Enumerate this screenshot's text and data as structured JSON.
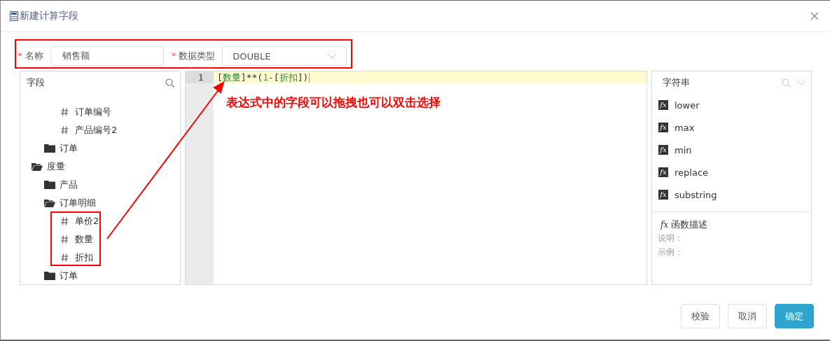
{
  "dialog": {
    "title": "新建计算字段"
  },
  "form": {
    "required_mark": "*",
    "name_label": "名称",
    "name_value": "销售额",
    "type_label": "数据类型",
    "type_value": "DOUBLE"
  },
  "fields_panel": {
    "title": "字段",
    "tree": [
      {
        "children": [
          {
            "children": [
              {
                "kind": "field",
                "label": "订单编号"
              },
              {
                "kind": "field",
                "label": "产品编号2"
              }
            ]
          },
          {
            "kind": "folder",
            "label": "订单",
            "expanded": false
          }
        ]
      },
      {
        "kind": "folder",
        "label": "度量",
        "expanded": true,
        "children": [
          {
            "kind": "folder",
            "label": "产品",
            "expanded": false
          },
          {
            "kind": "folder",
            "label": "订单明细",
            "expanded": true,
            "children": [
              {
                "kind": "field",
                "label": "单价2"
              },
              {
                "kind": "field",
                "label": "数量"
              },
              {
                "kind": "field",
                "label": "折扣"
              }
            ]
          },
          {
            "kind": "folder",
            "label": "订单",
            "expanded": false
          }
        ]
      }
    ]
  },
  "editor": {
    "line_number": "1",
    "tokens": [
      {
        "kind": "op",
        "text": "["
      },
      {
        "kind": "field",
        "text": "数量"
      },
      {
        "kind": "op",
        "text": "]**("
      },
      {
        "kind": "number",
        "text": "1"
      },
      {
        "kind": "op",
        "text": "-["
      },
      {
        "kind": "field",
        "text": "折扣"
      },
      {
        "kind": "op",
        "text": "])"
      }
    ]
  },
  "functions_panel": {
    "category": "字符串",
    "functions": [
      {
        "badge": "fx",
        "name": "lower"
      },
      {
        "badge": "fx",
        "name": "max"
      },
      {
        "badge": "fx",
        "name": "min"
      },
      {
        "badge": "fx",
        "name": "replace"
      },
      {
        "badge": "fx",
        "name": "substring"
      }
    ],
    "description": {
      "badge": "fx",
      "title": "函数描述",
      "explain_label": "说明：",
      "example_label": "示例："
    }
  },
  "annotation": {
    "text": "表达式中的字段可以拖拽也可以双击选择"
  },
  "buttons": [
    {
      "label": "校验",
      "primary": false
    },
    {
      "label": "取消",
      "primary": false
    },
    {
      "label": "确定",
      "primary": true
    }
  ]
}
